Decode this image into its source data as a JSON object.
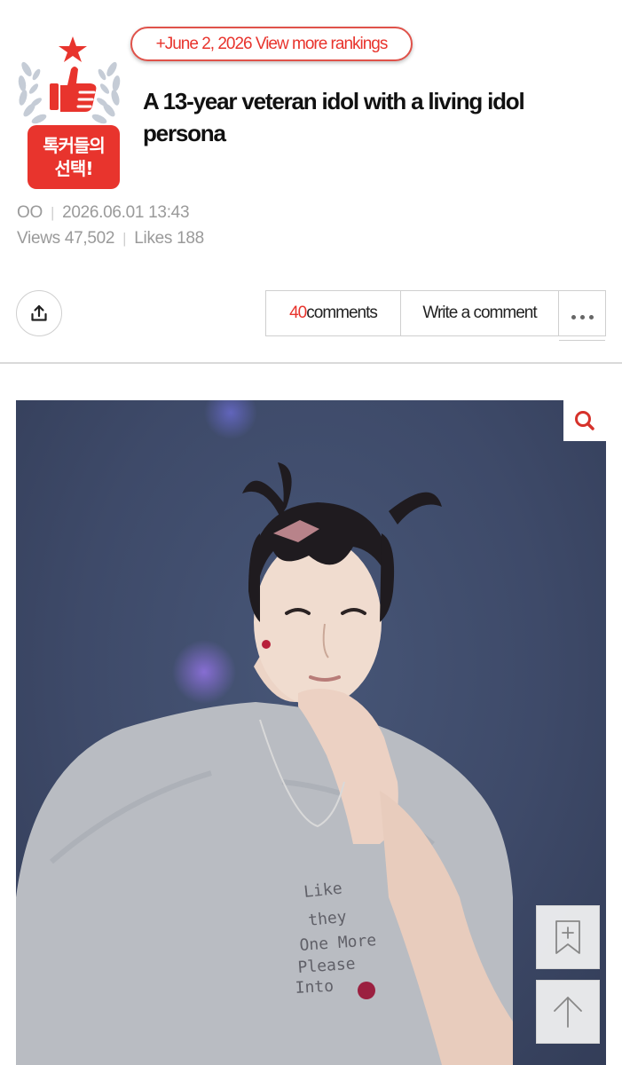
{
  "badge": {
    "line1": "톡커들의",
    "line2": "선택!",
    "colors": {
      "red": "#e8342d",
      "laurel": "#c5ccd6"
    }
  },
  "ranking_link": {
    "label": "+June 2, 2026 View more rankings"
  },
  "post": {
    "title": "A 13-year veteran idol with a living idol persona",
    "author": "OO",
    "datetime": "2026.06.01 13:43",
    "views_label": "Views",
    "views": "47,502",
    "likes_label": "Likes",
    "likes": "188"
  },
  "actions": {
    "comment_count": "40",
    "comments_label": "comments",
    "write_comment_label": "Write a comment",
    "share_icon": "share-upload-icon",
    "more_icon": "more-dots-icon"
  },
  "photo": {
    "zoom_icon": "search-icon",
    "bookmark_icon": "bookmark-add-icon",
    "scroll_top_icon": "arrow-up-icon"
  }
}
